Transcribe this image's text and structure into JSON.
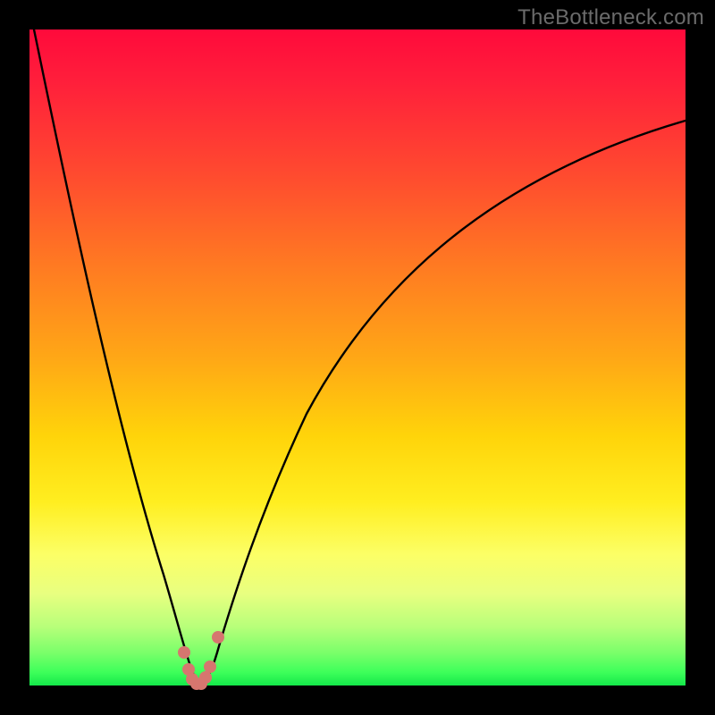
{
  "watermark": {
    "text": "TheBottleneck.com"
  },
  "chart_data": {
    "type": "line",
    "title": "",
    "xlabel": "",
    "ylabel": "",
    "xlim": [
      0,
      1
    ],
    "ylim": [
      0,
      1
    ],
    "background": "vertical-gradient red→yellow→green",
    "series": [
      {
        "name": "bottleneck-curve",
        "x": [
          0.0,
          0.03,
          0.06,
          0.09,
          0.12,
          0.15,
          0.18,
          0.21,
          0.24,
          0.245,
          0.25,
          0.255,
          0.26,
          0.27,
          0.28,
          0.285,
          0.29,
          0.3,
          0.34,
          0.38,
          0.44,
          0.52,
          0.62,
          0.74,
          0.88,
          1.0
        ],
        "values": [
          1.0,
          0.89,
          0.78,
          0.67,
          0.55,
          0.43,
          0.29,
          0.145,
          0.03,
          0.015,
          0.005,
          0.0,
          0.005,
          0.015,
          0.03,
          0.055,
          0.09,
          0.145,
          0.275,
          0.38,
          0.49,
          0.59,
          0.68,
          0.755,
          0.82,
          0.865
        ]
      }
    ],
    "markers": {
      "name": "bottom-cluster",
      "color": "#d6766f",
      "points": [
        {
          "x": 0.236,
          "y": 0.05
        },
        {
          "x": 0.242,
          "y": 0.025
        },
        {
          "x": 0.248,
          "y": 0.01
        },
        {
          "x": 0.255,
          "y": 0.003
        },
        {
          "x": 0.262,
          "y": 0.003
        },
        {
          "x": 0.268,
          "y": 0.012
        },
        {
          "x": 0.275,
          "y": 0.028
        },
        {
          "x": 0.288,
          "y": 0.073
        }
      ]
    }
  }
}
